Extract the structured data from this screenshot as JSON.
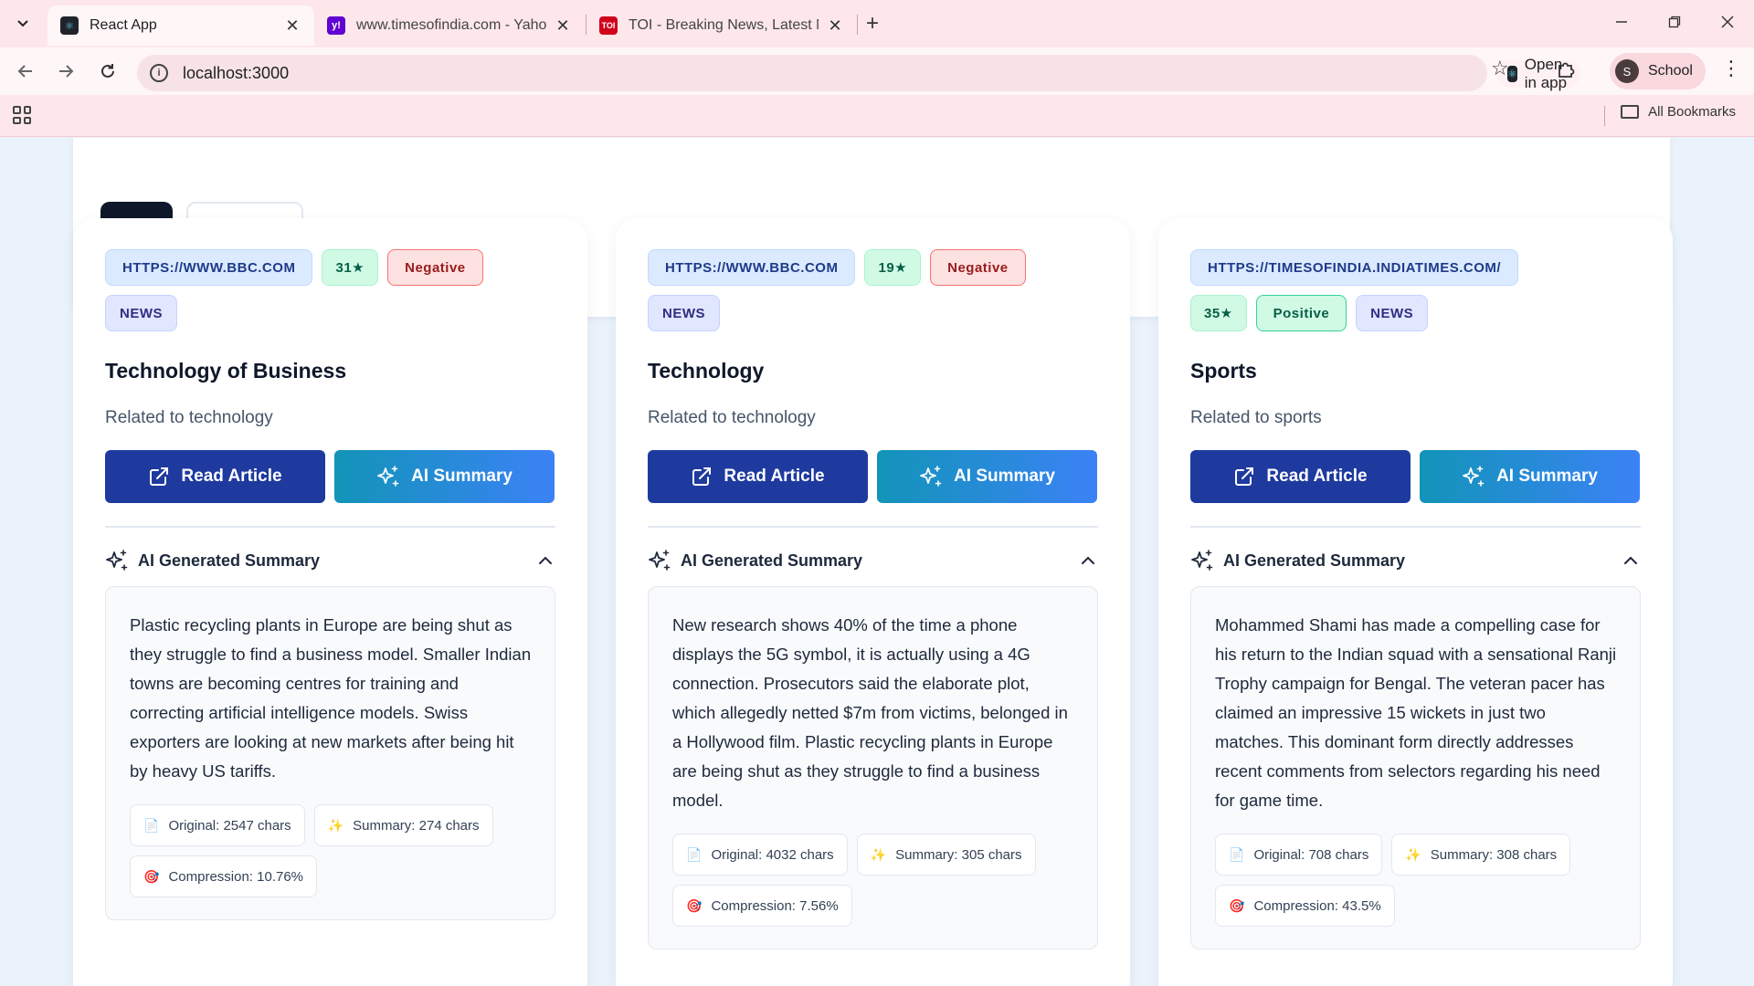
{
  "browser": {
    "tabs": [
      {
        "title": "React App",
        "favicon": "react-icon",
        "active": true
      },
      {
        "title": "www.timesofindia.com - Yahoo",
        "favicon": "yahoo-icon",
        "active": false
      },
      {
        "title": "TOI - Breaking News, Latest Ne",
        "favicon": "toi-icon",
        "active": false
      }
    ],
    "url": "localhost:3000",
    "open_in_app": "Open in app",
    "profile_initial": "S",
    "profile_name": "School",
    "all_bookmarks": "All Bookmarks"
  },
  "cards": [
    {
      "source": "HTTPS://WWW.BBC.COM",
      "rating": "31★",
      "sentiment": "Negative",
      "category": "NEWS",
      "title": "Technology of Business",
      "description": "Related to technology",
      "read_label": "Read Article",
      "summary_btn_label": "AI Summary",
      "summary_heading": "AI Generated Summary",
      "summary_text": "Plastic recycling plants in Europe are being shut as they struggle to find a business model. Smaller Indian towns are becoming centres for training and correcting artificial intelligence models. Swiss exporters are looking at new markets after being hit by heavy US tariffs.",
      "original": "Original: 2547 chars",
      "summary_len": "Summary: 274 chars",
      "compression": "Compression: 10.76%"
    },
    {
      "source": "HTTPS://WWW.BBC.COM",
      "rating": "19★",
      "sentiment": "Negative",
      "category": "NEWS",
      "title": "Technology",
      "description": "Related to technology",
      "read_label": "Read Article",
      "summary_btn_label": "AI Summary",
      "summary_heading": "AI Generated Summary",
      "summary_text": "New research shows 40% of the time a phone displays the 5G symbol, it is actually using a 4G connection. Prosecutors said the elaborate plot, which allegedly netted $7m from victims, belonged in a Hollywood film. Plastic recycling plants in Europe are being shut as they struggle to find a business model.",
      "original": "Original: 4032 chars",
      "summary_len": "Summary: 305 chars",
      "compression": "Compression: 7.56%"
    },
    {
      "source": "HTTPS://TIMESOFINDIA.INDIATIMES.COM/",
      "rating": "35★",
      "sentiment": "Positive",
      "category": "NEWS",
      "title": "Sports",
      "description": "Related to sports",
      "read_label": "Read Article",
      "summary_btn_label": "AI Summary",
      "summary_heading": "AI Generated Summary",
      "summary_text": "Mohammed Shami has made a compelling case for his return to the Indian squad with a sensational Ranji Trophy campaign for Bengal. The veteran pacer has claimed an impressive 15 wickets in just two matches. This dominant form directly addresses recent comments from selectors regarding his need for game time.",
      "original": "Original: 708 chars",
      "summary_len": "Summary: 308 chars",
      "compression": "Compression: 43.5%"
    }
  ],
  "colors": {
    "read_button": "#1e3a9f",
    "summary_gradient_start": "#1294b8",
    "summary_gradient_end": "#3b82f6",
    "negative": "#991b1b",
    "positive": "#065f46"
  }
}
